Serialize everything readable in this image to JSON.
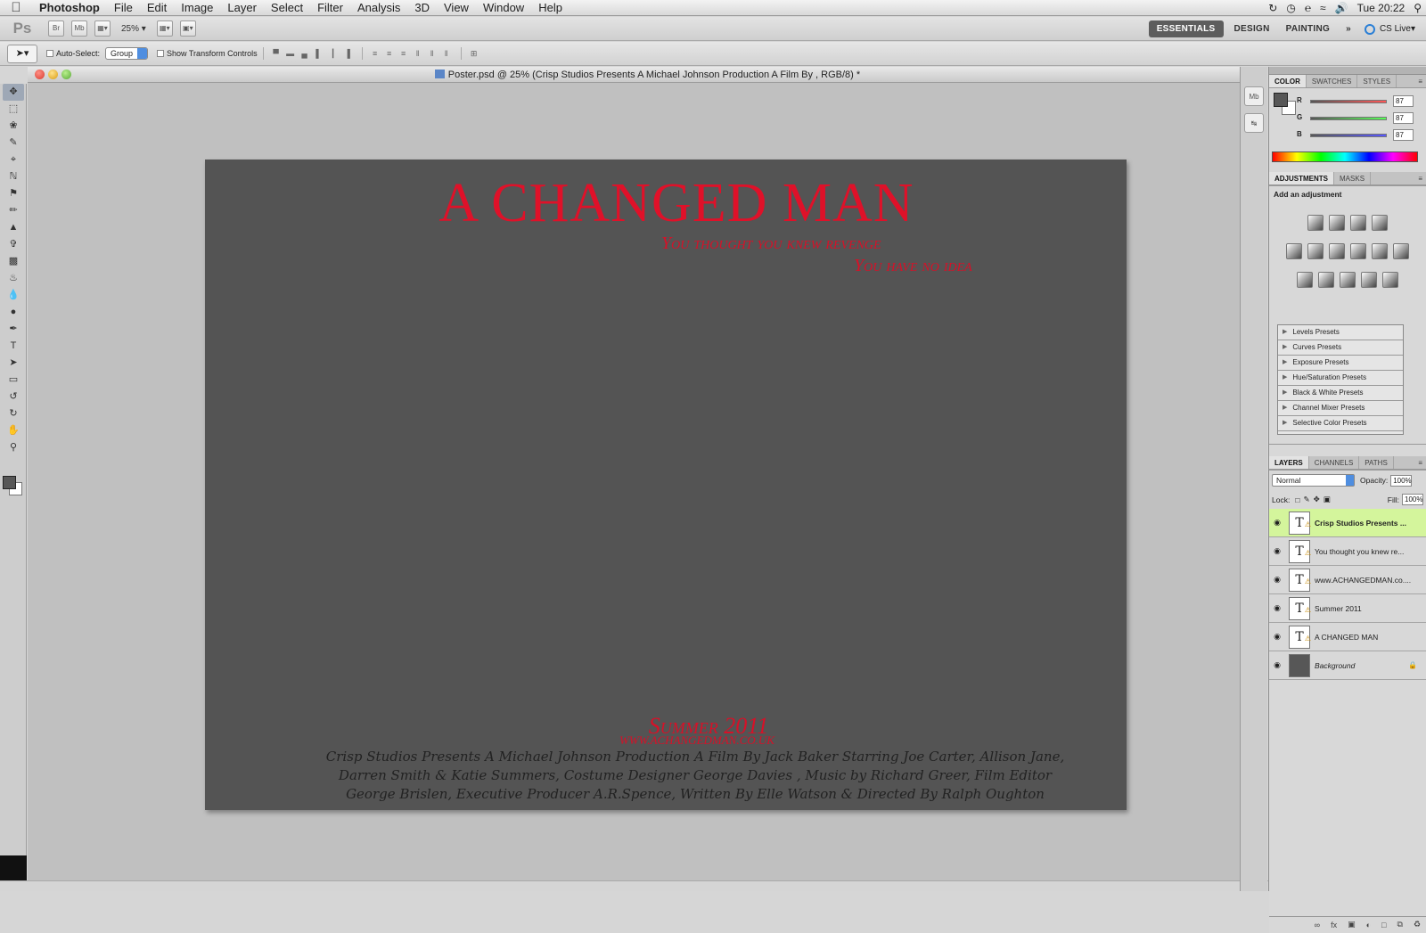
{
  "menubar": {
    "app": "Photoshop",
    "items": [
      "File",
      "Edit",
      "Image",
      "Layer",
      "Select",
      "Filter",
      "Analysis",
      "3D",
      "View",
      "Window",
      "Help"
    ],
    "clock": "Tue 20:22"
  },
  "appbar": {
    "logo": "Ps",
    "bridge": "Br",
    "minibridge": "Mb",
    "zoom": "25%",
    "workspaces": [
      "ESSENTIALS",
      "DESIGN",
      "PAINTING"
    ],
    "more": "»",
    "cslive": "CS Live"
  },
  "options": {
    "auto_select": "Auto-Select:",
    "auto_select_value": "Group",
    "show_transform": "Show Transform Controls"
  },
  "document": {
    "title": "Poster.psd @ 25% (Crisp Studios Presents  A Michael Johnson Production A Film By , RGB/8) *"
  },
  "poster": {
    "title": "A CHANGED MAN",
    "tag1": "You thought you knew revenge",
    "tag2": "You have no idea",
    "summer": "Summer 2011",
    "www": "WWW.ACHANGEDMAN.CO.UK",
    "credits": "Crisp Studios Presents  A Michael Johnson Production A Film By  Jack Baker Starring Joe Carter, Allison Jane, Darren Smith & Katie Summers, Costume Designer George Davies , Music by Richard Greer, Film Editor George Brislen, Executive Producer A.R.Spence, Written By Elle Watson & Directed By Ralph Oughton"
  },
  "color_panel": {
    "tabs": [
      "COLOR",
      "SWATCHES",
      "STYLES"
    ],
    "r": "87",
    "g": "87",
    "b": "87",
    "r_label": "R",
    "g_label": "G",
    "b_label": "B"
  },
  "adjustments": {
    "tabs": [
      "ADJUSTMENTS",
      "MASKS"
    ],
    "heading": "Add an adjustment",
    "presets": [
      "Levels Presets",
      "Curves Presets",
      "Exposure Presets",
      "Hue/Saturation Presets",
      "Black & White Presets",
      "Channel Mixer Presets",
      "Selective Color Presets"
    ]
  },
  "layers": {
    "tabs": [
      "LAYERS",
      "CHANNELS",
      "PATHS"
    ],
    "blend_mode": "Normal",
    "opacity_label": "Opacity:",
    "opacity": "100%",
    "lock_label": "Lock:",
    "fill_label": "Fill:",
    "fill": "100%",
    "items": [
      {
        "name": "Crisp Studios Presents  ..."
      },
      {
        "name": "You thought you knew re..."
      },
      {
        "name": "www.ACHANGEDMAN.co...."
      },
      {
        "name": "Summer 2011"
      },
      {
        "name": "A CHANGED MAN"
      },
      {
        "name": "Background"
      }
    ]
  },
  "colors": {
    "poster_bg": "#545454",
    "title_red": "#df1129",
    "active_layer": "#d4f59c",
    "workspace_active": "#5d5d5d"
  }
}
